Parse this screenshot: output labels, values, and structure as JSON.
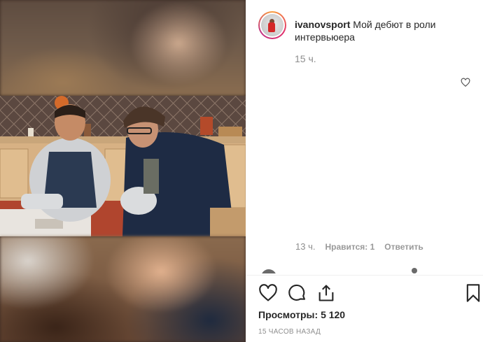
{
  "post": {
    "username": "ivanovsport",
    "caption": "Мой дебют в роли интервьюера",
    "caption_time": "15 ч."
  },
  "comment": {
    "time": "13 ч.",
    "likes_label": "Нравится: 1",
    "reply_label": "Ответить"
  },
  "stats": {
    "views_label": "Просмотры:",
    "views_value": "5 120",
    "posted_ago": "15 часов назад"
  },
  "icons": {
    "like": "heart-icon",
    "comment": "comment-bubble-icon",
    "share": "share-icon",
    "save": "bookmark-icon",
    "comment_like": "heart-icon-small"
  },
  "colors": {
    "text": "#262626",
    "muted": "#8e8e8e",
    "divider": "#efefef",
    "story_ring_from": "#f9a03f",
    "story_ring_to": "#c13584"
  }
}
